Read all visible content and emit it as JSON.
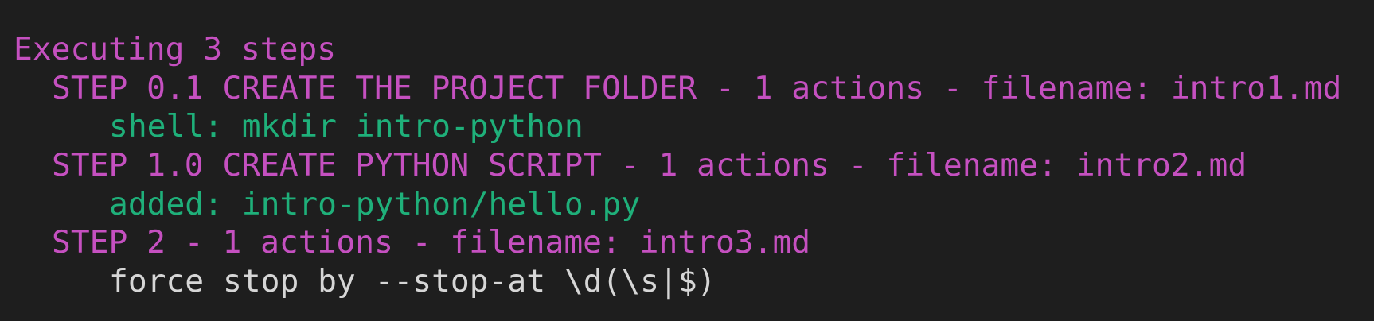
{
  "terminal": {
    "header": "Executing 3 steps",
    "steps": [
      {
        "title": "STEP 0.1 CREATE THE PROJECT FOLDER - 1 actions - filename: intro1.md",
        "action": "shell: mkdir intro-python"
      },
      {
        "title": "STEP 1.0 CREATE PYTHON SCRIPT - 1 actions - filename: intro2.md",
        "action": "added: intro-python/hello.py"
      },
      {
        "title": "STEP 2 - 1 actions - filename: intro3.md",
        "action": "force stop by --stop-at \\d(\\s|$)"
      }
    ]
  },
  "colors": {
    "background": "#1e1e1e",
    "step_text": "#c550c0",
    "action_success": "#1fb07a",
    "action_info": "#d6d6d6"
  }
}
